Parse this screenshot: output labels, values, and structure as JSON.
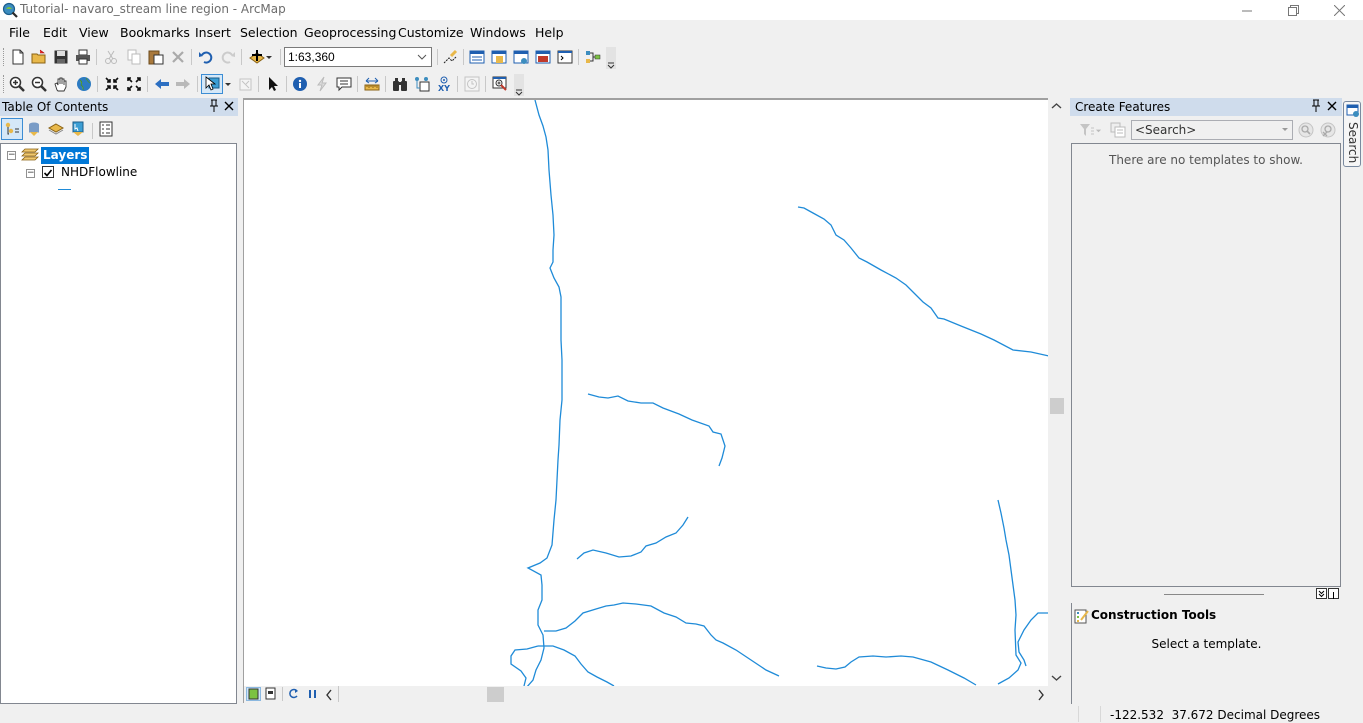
{
  "window": {
    "title": "Tutorial- navaro_stream line region - ArcMap",
    "controls": [
      "minimize",
      "restore",
      "close"
    ]
  },
  "menubar": {
    "items": [
      "File",
      "Edit",
      "View",
      "Bookmarks",
      "Insert",
      "Selection",
      "Geoprocessing",
      "Customize",
      "Windows",
      "Help"
    ]
  },
  "standard_toolbar": {
    "buttons": [
      "new-document",
      "open",
      "save",
      "print",
      "cut",
      "copy",
      "paste",
      "delete",
      "undo",
      "redo",
      "add-data"
    ],
    "scale": "1:63,360",
    "buttons_after_scale": [
      "editor-toolbar",
      "table-of-contents",
      "catalog",
      "search-window",
      "arctoolbox",
      "python-window",
      "model-builder"
    ]
  },
  "tools_toolbar": {
    "buttons": [
      "zoom-in",
      "zoom-out",
      "pan",
      "full-extent",
      "fixed-zoom-in",
      "fixed-zoom-out",
      "go-back",
      "go-forward",
      "select-features",
      "clear-selection",
      "select-elements",
      "identify",
      "hyperlink",
      "html-popup",
      "measure",
      "find",
      "find-route",
      "go-to-xy",
      "time-slider",
      "magnifier"
    ]
  },
  "toc": {
    "title": "Table Of Contents",
    "toolbar": [
      "list-by-drawing-order",
      "list-by-source",
      "list-by-visibility",
      "list-by-selection",
      "options"
    ],
    "tree": {
      "root_label": "Layers",
      "root_selected": true,
      "layers": [
        {
          "name": "NHDFlowline",
          "visible": true,
          "symbol_color": "#1f8bd8"
        }
      ]
    }
  },
  "map": {
    "line_color": "#1f8bd8",
    "view_buttons": [
      "data-view",
      "layout-view",
      "refresh",
      "pause-drawing"
    ]
  },
  "create_features": {
    "title": "Create Features",
    "search_placeholder": "<Search>",
    "empty_message": "There are no templates to show."
  },
  "construction_tools": {
    "title": "Construction Tools",
    "message": "Select a template."
  },
  "side_tab": {
    "label": "Search"
  },
  "statusbar": {
    "coordinates": "-122.532  37.672 Decimal Degrees"
  }
}
